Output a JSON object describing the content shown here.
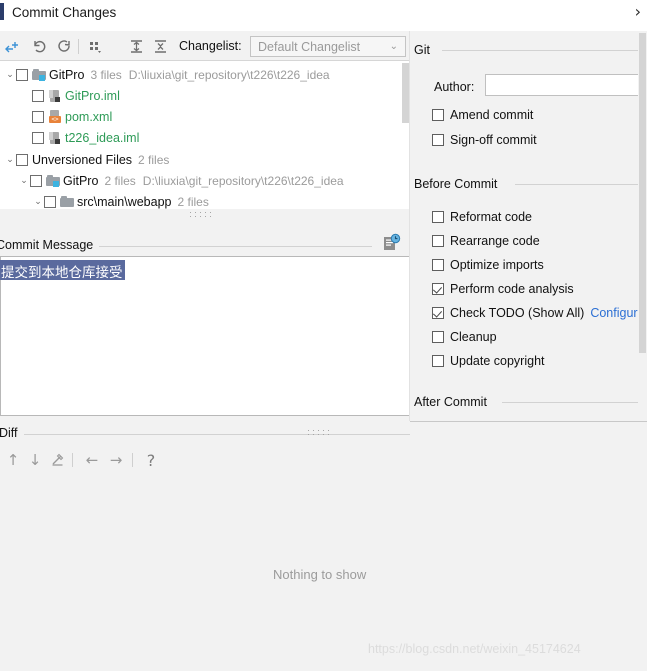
{
  "window": {
    "title": "Commit Changes",
    "expand_chevron": "›"
  },
  "toolbar": {
    "icons": [
      {
        "name": "add-to-vcs-icon",
        "glyph": "⤷"
      },
      {
        "name": "revert-icon",
        "glyph": "↶"
      },
      {
        "name": "refresh-icon",
        "glyph": "↻"
      },
      {
        "name": "group-by-icon",
        "glyph": "⠿"
      },
      {
        "name": "expand-all-icon",
        "glyph": "⩝"
      },
      {
        "name": "collapse-all-icon",
        "glyph": "⩞"
      }
    ],
    "changelist_label": "Changelist:",
    "changelist_label_mnemonic": "C",
    "changelist_value": "Default Changelist",
    "changelist_arrow": "⌄"
  },
  "tree": {
    "nodes": [
      {
        "name": "GitPro",
        "meta": "3 files",
        "path": "D:\\liuxia\\git_repository\\t226\\t226_idea",
        "icon": "folder-icon",
        "twisty": "⌄",
        "indent": 0,
        "checked": false,
        "color": "default"
      },
      {
        "name": "GitPro.iml",
        "meta": "",
        "path": "",
        "icon": "module-file-icon",
        "twisty": "",
        "indent": 1,
        "checked": false,
        "color": "green"
      },
      {
        "name": "pom.xml",
        "meta": "",
        "path": "",
        "icon": "xml-file-icon",
        "twisty": "",
        "indent": 1,
        "checked": false,
        "color": "green"
      },
      {
        "name": "t226_idea.iml",
        "meta": "",
        "path": "",
        "icon": "module-file-icon",
        "twisty": "",
        "indent": 1,
        "checked": false,
        "color": "green"
      },
      {
        "name": "Unversioned Files",
        "meta": "2 files",
        "path": "",
        "icon": "",
        "twisty": "⌄",
        "indent": 0,
        "checked": false,
        "color": "default"
      },
      {
        "name": "GitPro",
        "meta": "2 files",
        "path": "D:\\liuxia\\git_repository\\t226\\t226_idea",
        "icon": "folder-icon",
        "twisty": "⌄",
        "indent": 1,
        "checked": false,
        "color": "default"
      },
      {
        "name": "src\\main\\webapp",
        "meta": "2 files",
        "path": "",
        "icon": "folder-icon",
        "twisty": "⌄",
        "indent": 2,
        "checked": false,
        "color": "default"
      }
    ]
  },
  "commit_message": {
    "section_title": "Commit Message",
    "value": "提交到本地仓库接受",
    "history_icon": "commit-message-history-icon"
  },
  "git_section": {
    "title": "Git",
    "author_label": "Author:",
    "author_label_mnemonic": "A",
    "author_value": "",
    "checkboxes": [
      {
        "label": "Amend commit",
        "mnemonic": "m",
        "checked": false
      },
      {
        "label": "Sign-off commit",
        "mnemonic": "g",
        "checked": false
      }
    ]
  },
  "before_commit_section": {
    "title": "Before Commit",
    "checkboxes": [
      {
        "label": "Reformat code",
        "mnemonic": "R",
        "checked": false,
        "link": ""
      },
      {
        "label": "Rearrange code",
        "mnemonic": "n",
        "checked": false,
        "link": ""
      },
      {
        "label": "Optimize imports",
        "mnemonic": "O",
        "checked": false,
        "link": ""
      },
      {
        "label": "Perform code analysis",
        "mnemonic": "s",
        "checked": true,
        "link": ""
      },
      {
        "label": "Check TODO (Show All)",
        "mnemonic": "",
        "checked": true,
        "link": "Configure"
      },
      {
        "label": "Cleanup",
        "mnemonic": "l",
        "checked": false,
        "link": ""
      },
      {
        "label": "Update copyright",
        "mnemonic": "",
        "checked": false,
        "link": ""
      }
    ]
  },
  "after_commit_section": {
    "title": "After Commit"
  },
  "diff_section": {
    "title": "Diff",
    "buttons": [
      {
        "name": "previous-difference-icon",
        "glyph": "↑"
      },
      {
        "name": "next-difference-icon",
        "glyph": "↓"
      },
      {
        "name": "edit-source-icon",
        "glyph": "╱"
      },
      {
        "name": "previous-file-icon",
        "glyph": "←"
      },
      {
        "name": "next-file-icon",
        "glyph": "→"
      },
      {
        "name": "help-icon",
        "glyph": "?"
      }
    ],
    "empty_text": "Nothing to show"
  },
  "watermark": {
    "text": "https://blog.csdn.net/weixin_45174624"
  }
}
